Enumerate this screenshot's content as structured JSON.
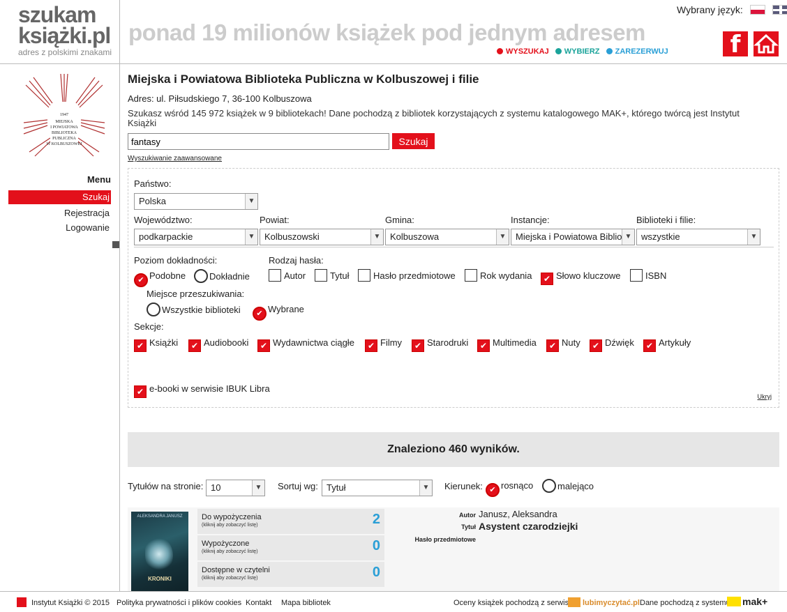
{
  "header": {
    "logo_top": "szukam",
    "logo_bottom": "książki.pl",
    "logo_sub": "adres z polskimi znakami",
    "tagline": "ponad 19 milionów książek pod jednym adresem",
    "steps": [
      {
        "label": "WYSZUKAJ",
        "color": "#e3101b"
      },
      {
        "label": "WYBIERZ",
        "color": "#1aa39a"
      },
      {
        "label": "ZAREZERWUJ",
        "color": "#2a9fd6"
      }
    ],
    "lang_label": "Wybrany język:",
    "facebook_glyph": "f"
  },
  "sidebar": {
    "menu_title": "Menu",
    "items": [
      "Szukaj",
      "Rejestracja",
      "Logowanie"
    ]
  },
  "main": {
    "library_title": "Miejska i Powiatowa Biblioteka Publiczna w Kolbuszowej i filie",
    "address": "Adres: ul. Piłsudskiego 7, 36-100 Kolbuszowa",
    "info": "Szukasz wśród 145 972 książek w 9 bibliotekach! Dane pochodzą z bibliotek korzystających z systemu katalogowego MAK+, którego twórcą jest Instytut Książki",
    "search_value": "fantasy",
    "search_button": "Szukaj",
    "advanced_link": "Wyszukiwanie zaawansowane"
  },
  "filters": {
    "country_label": "Państwo:",
    "country_value": "Polska",
    "voivodeship_label": "Województwo:",
    "voivodeship_value": "podkarpackie",
    "county_label": "Powiat:",
    "county_value": "Kolbuszowski",
    "commune_label": "Gmina:",
    "commune_value": "Kolbuszowa",
    "instance_label": "Instancje:",
    "instance_value": "Miejska i Powiatowa Bibliot",
    "libraries_label": "Biblioteki i filie:",
    "libraries_value": "wszystkie",
    "precision_label": "Poziom dokładności:",
    "precision_options": [
      {
        "label": "Podobne",
        "checked": true
      },
      {
        "label": "Dokładnie",
        "checked": false
      }
    ],
    "keyword_type_label": "Rodzaj hasła:",
    "keyword_types": [
      {
        "label": "Autor",
        "checked": false
      },
      {
        "label": "Tytuł",
        "checked": false
      },
      {
        "label": "Hasło przedmiotowe",
        "checked": false
      },
      {
        "label": "Rok wydania",
        "checked": false
      },
      {
        "label": "Słowo kluczowe",
        "checked": true
      },
      {
        "label": "ISBN",
        "checked": false
      }
    ],
    "place_label": "Miejsce przeszukiwania:",
    "place_options": [
      {
        "label": "Wszystkie biblioteki",
        "checked": false
      },
      {
        "label": "Wybrane",
        "checked": true
      }
    ],
    "sections_label": "Sekcje:",
    "sections": [
      {
        "label": "Książki",
        "checked": true
      },
      {
        "label": "Audiobooki",
        "checked": true
      },
      {
        "label": "Wydawnictwa ciągłe",
        "checked": true
      },
      {
        "label": "Filmy",
        "checked": true
      },
      {
        "label": "Starodruki",
        "checked": true
      },
      {
        "label": "Multimedia",
        "checked": true
      },
      {
        "label": "Nuty",
        "checked": true
      },
      {
        "label": "Dźwięk",
        "checked": true
      },
      {
        "label": "Artykuły",
        "checked": true
      }
    ],
    "ebooks_label": "e-booki w serwisie IBUK Libra",
    "ebooks_checked": true,
    "hide_link": "Ukryj"
  },
  "results": {
    "summary": "Znaleziono 460 wyników.",
    "per_page_label": "Tytułów na stronie:",
    "per_page_value": "10",
    "sort_label": "Sortuj wg:",
    "sort_value": "Tytuł",
    "direction_label": "Kierunek:",
    "direction_options": [
      {
        "label": "rosnąco",
        "checked": true
      },
      {
        "label": "malejąco",
        "checked": false
      }
    ]
  },
  "record": {
    "cover_top": "ALEKSANDRA   JANUSZ",
    "cover_title": "KRONIKI",
    "availability": [
      {
        "label": "Do wypożyczenia",
        "sub": "(kliknij aby zobaczyć listę)",
        "count": "2"
      },
      {
        "label": "Wypożyczone",
        "sub": "(kliknij aby zobaczyć listę)",
        "count": "0"
      },
      {
        "label": "Dostępne w czytelni",
        "sub": "(kliknij aby zobaczyć listę)",
        "count": "0"
      }
    ],
    "author_label": "Autor",
    "author": "Janusz, Aleksandra",
    "title_label": "Tytuł",
    "title": "Asystent czarodziejki",
    "subject_label": "Hasło przedmiotowe"
  },
  "footer": {
    "copyright": "Instytut Książki © 2015",
    "links": [
      "Polityka prywatności i plików cookies",
      "Kontakt",
      "Mapa bibliotek"
    ],
    "ratings_text": "Oceny książek pochodzą z serwisu",
    "ratings_logo": "lubimyczytać.pl",
    "data_text": "Dane pochodzą z systemu",
    "mak_logo": "mak+"
  }
}
